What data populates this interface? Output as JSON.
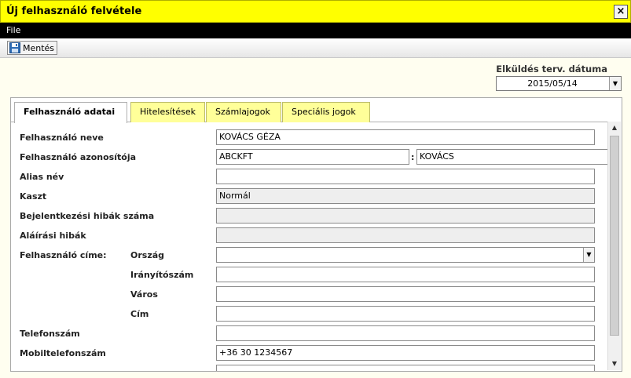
{
  "window": {
    "title": "Új felhasználó felvétele",
    "close": "×"
  },
  "menu": {
    "file": "File"
  },
  "toolbar": {
    "save_label": "Mentés"
  },
  "date": {
    "label": "Elküldés terv. dátuma",
    "value": "2015/05/14"
  },
  "tabs": [
    "Felhasználó adatai",
    "Hitelesítések",
    "Számlajogok",
    "Speciális jogok"
  ],
  "form": {
    "username_label": "Felhasználó neve",
    "username": "KOVÁCS GÉZA",
    "userid_label": "Felhasználó azonosítója",
    "userid_prefix": "ABCKFT",
    "userid_sep": ":",
    "userid": "KOVÁCS",
    "alias_label": "Alias név",
    "alias": "",
    "caste_label": "Kaszt",
    "caste": "Normál",
    "login_errors_label": "Bejelentkezési hibák száma",
    "login_errors": "",
    "sign_errors_label": "Aláírási hibák",
    "sign_errors": "",
    "address_label": "Felhasználó címe:",
    "country_label": "Ország",
    "country": "",
    "zip_label": "Irányítószám",
    "zip": "",
    "city_label": "Város",
    "city": "",
    "street_label": "Cím",
    "street": "",
    "phone_label": "Telefonszám",
    "phone": "",
    "mobile_label": "Mobiltelefonszám",
    "mobile": "+36 30 1234567"
  }
}
